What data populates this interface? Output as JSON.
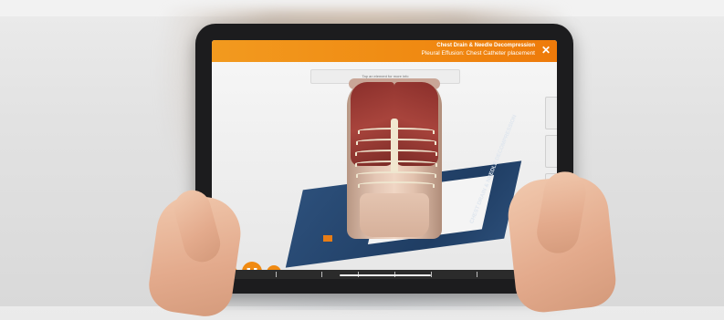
{
  "app": {
    "header_title": "Chest Drain & Needle Decompression",
    "header_subtitle": "Pleural Effusion: Chest Catheter placement",
    "close_icon": "close-icon"
  },
  "instruction": "Tap an element for more info",
  "ar_card": {
    "label": "CHEST DRAIN & NEEDLE DECOMPRESSION"
  },
  "controls": {
    "prev_icon": "skip-back-icon",
    "pause_icon": "pause-icon",
    "next_icon": "skip-forward-icon"
  },
  "timeline": {
    "progress_fraction": 0.05
  },
  "colors": {
    "accent": "#f08a12",
    "header_gradient_end": "#ee7a0a",
    "ar_card_blue": "#1f3d63"
  }
}
